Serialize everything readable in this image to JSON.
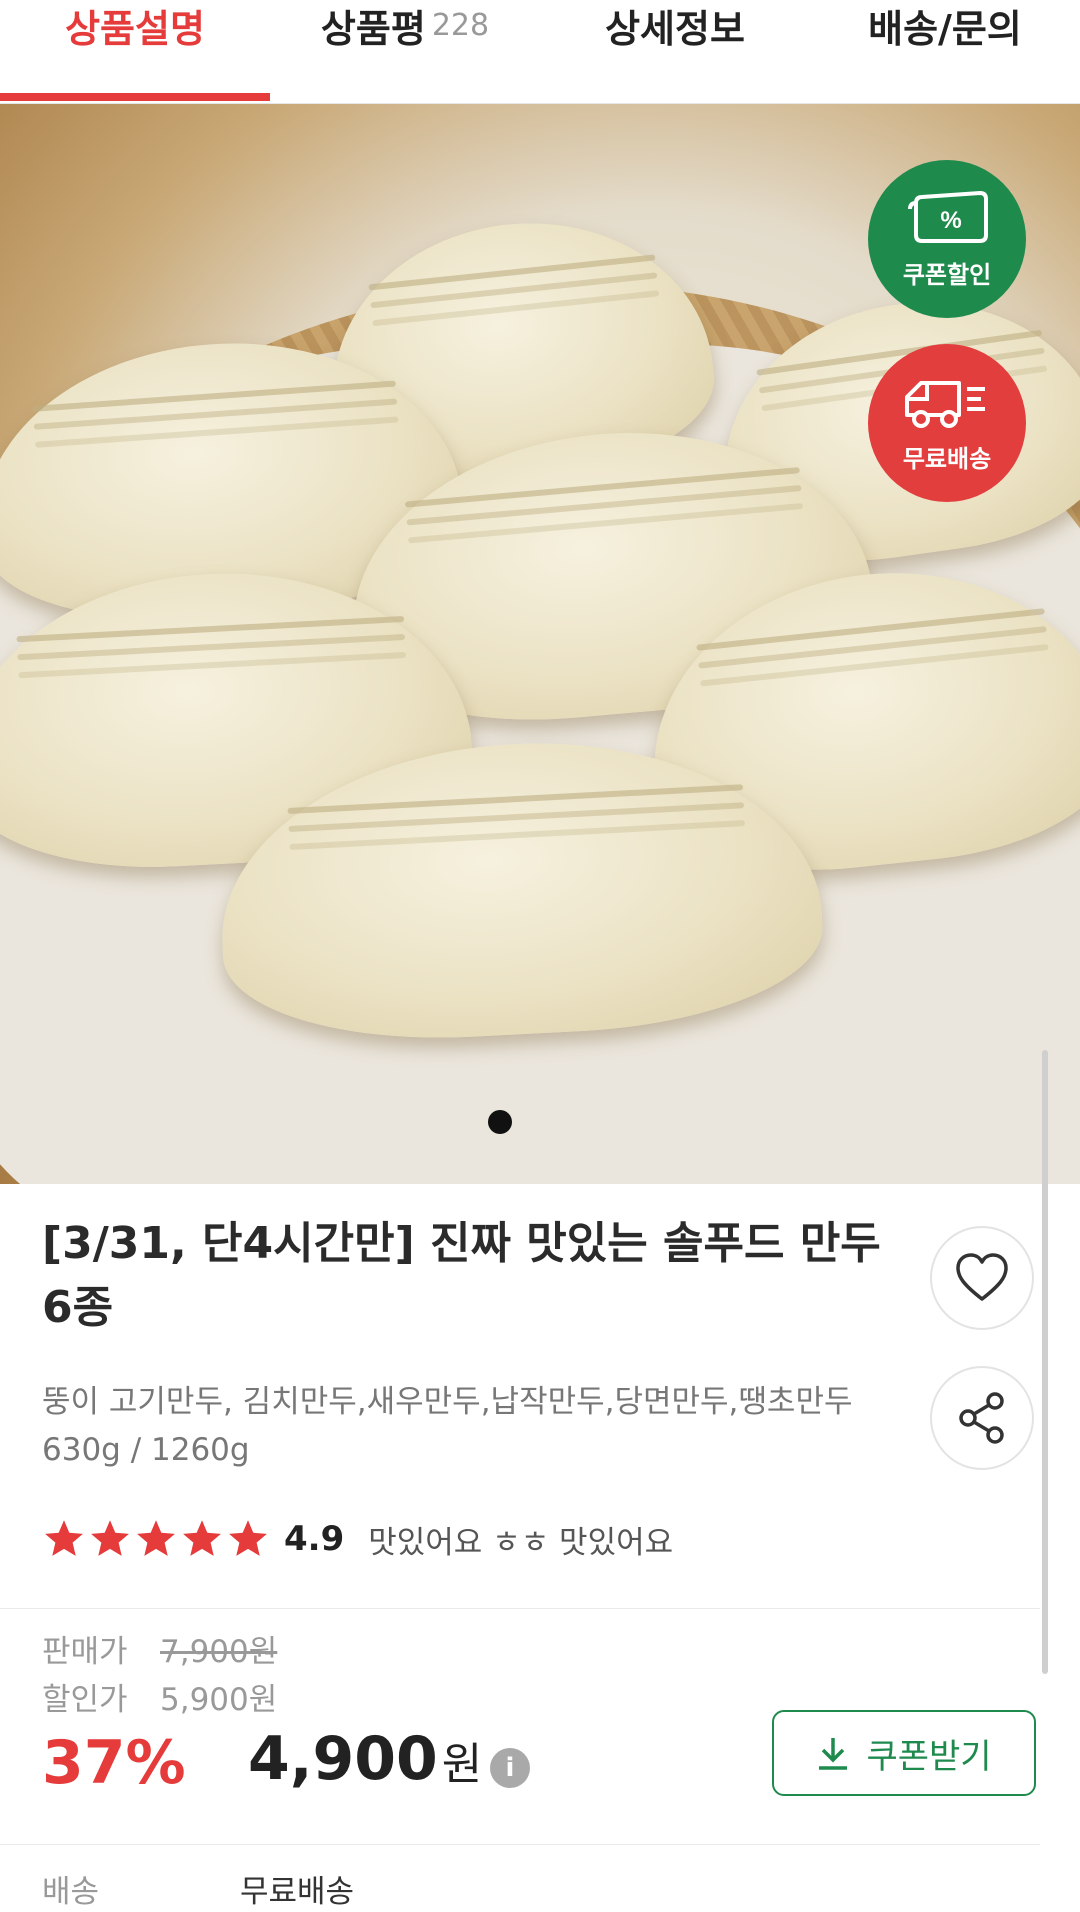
{
  "tabs": [
    {
      "label": "상품설명",
      "active": true
    },
    {
      "label": "상품평",
      "count": "228"
    },
    {
      "label": "상세정보"
    },
    {
      "label": "배송/문의"
    }
  ],
  "badges": {
    "coupon_label": "쿠폰할인",
    "coupon_symbol": "%",
    "free_label": "무료배송"
  },
  "product": {
    "title": "[3/31, 단4시간만] 진짜 맛있는 솔푸드 만두 6종",
    "description": "뚱이 고기만두, 김치만두,새우만두,납작만두,당면만두,땡초만두 630g / 1260g",
    "rating": "4.9",
    "rating_stars": 5,
    "review_snippet": "맛있어요 ㅎㅎ 맛있어요"
  },
  "price": {
    "sale_label": "판매가",
    "sale_value": "7,900원",
    "discount_label": "할인가",
    "discount_value": "5,900원",
    "discount_rate": "37%",
    "final_amount": "4,900",
    "final_unit": "원",
    "info_symbol": "i",
    "coupon_button": "쿠폰받기"
  },
  "shipping": {
    "label": "배송",
    "value": "무료배송"
  },
  "colors": {
    "accent_red": "#e53b3b",
    "coupon_green": "#1e8a4c"
  }
}
